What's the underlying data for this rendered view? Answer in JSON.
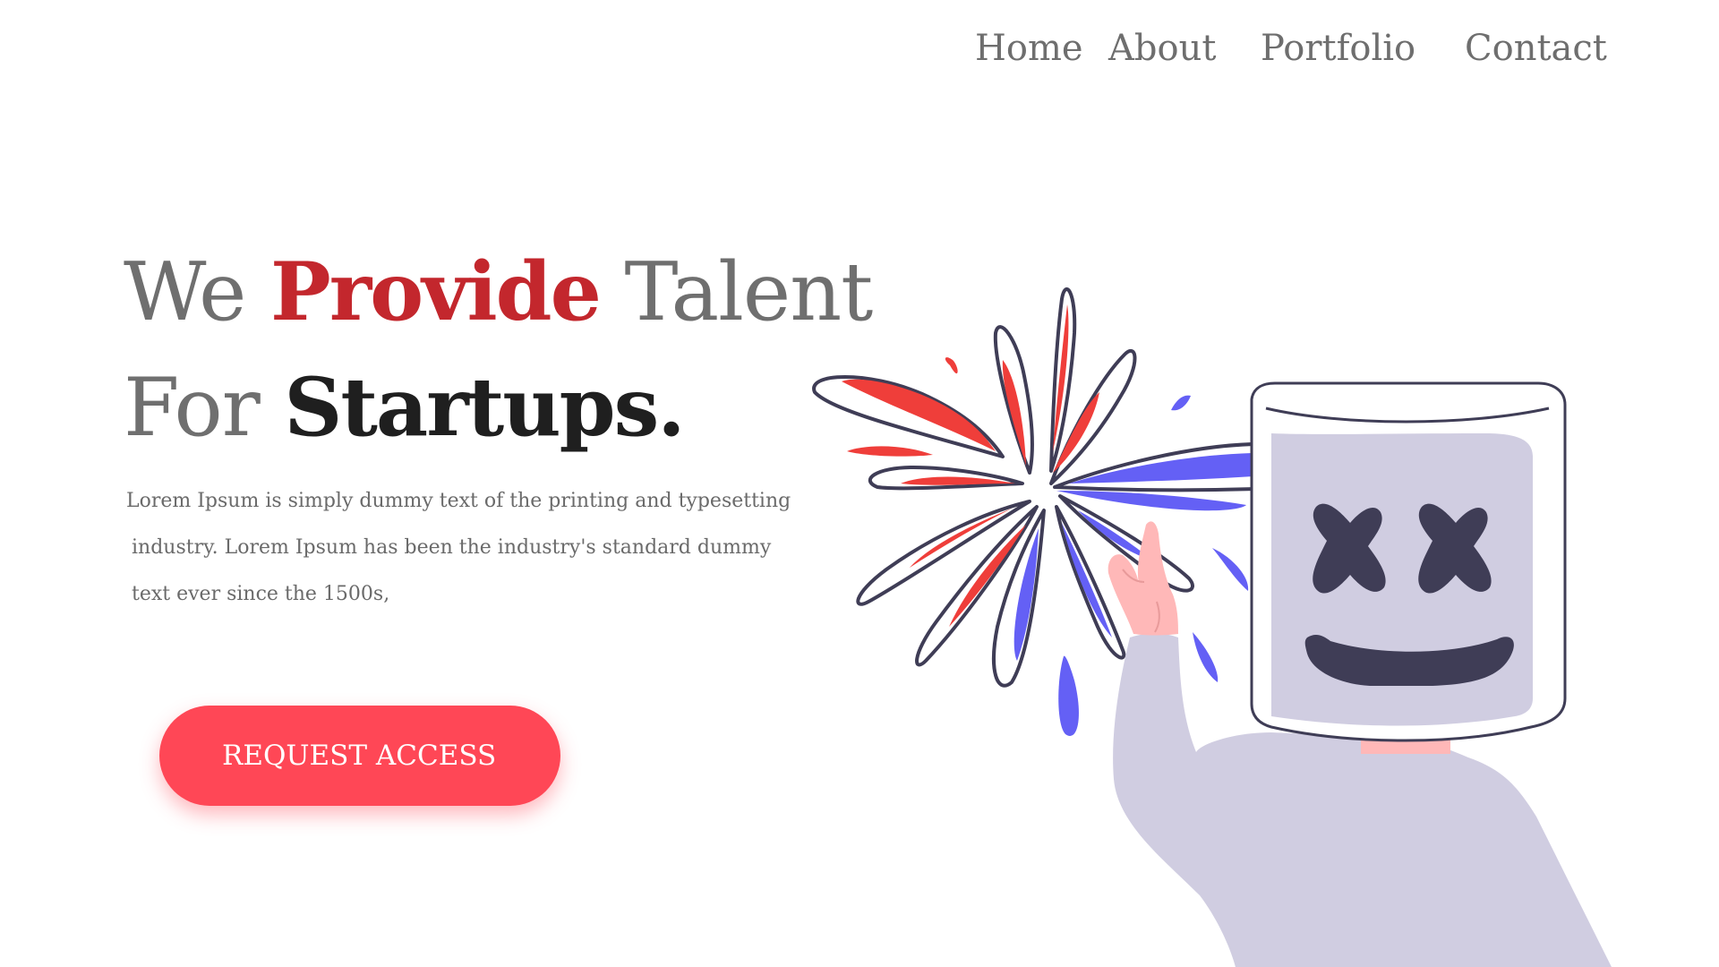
{
  "nav": {
    "items": [
      {
        "label": "Home"
      },
      {
        "label": "About"
      },
      {
        "label": "Portfolio"
      },
      {
        "label": "Contact"
      }
    ]
  },
  "hero": {
    "title_line1_prefix": "We ",
    "title_line1_accent": "Provide",
    "title_line1_suffix": " Talent",
    "title_line2_prefix": "For ",
    "title_line2_strong": "Startups.",
    "body_lines": [
      "Lorem Ipsum is simply dummy text of the printing and typesetting",
      "industry. Lorem Ipsum has been the industry's standard dummy",
      "text ever since the 1500s,"
    ],
    "cta_label": "REQUEST ACCESS"
  },
  "colors": {
    "accent": "#c3272d",
    "button": "#ff4756",
    "nav_text": "#6e6e6e",
    "illustration_blue": "#6460f5",
    "illustration_red": "#ef3e3a",
    "illustration_outline": "#3f3d56",
    "illustration_mask": "#d0cde1",
    "illustration_skin": "#ffb8b8"
  },
  "illustration": {
    "icon": "marshmello-fireworks-illustration"
  }
}
